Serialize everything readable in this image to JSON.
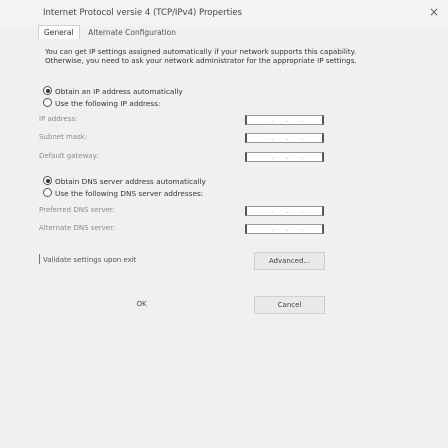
{
  "window": {
    "title": "Internet Protocol versie 4 (TCP/IPv4) Properties",
    "close_glyph": "×"
  },
  "tabs": [
    {
      "label": "General",
      "active": true
    },
    {
      "label": "Alternate Configuration",
      "active": false
    }
  ],
  "description": "You can get IP settings assigned automatically if your network supports this capability. Otherwise, you need to ask your network administrator for the appropriate IP settings.",
  "ip_section": {
    "auto_label": "Obtain an IP address automatically",
    "manual_label": "Use the following IP address:",
    "selected": "auto",
    "fields": [
      {
        "label": "IP address:",
        "value": ".   .   ."
      },
      {
        "label": "Subnet mask:",
        "value": ".   .   ."
      },
      {
        "label": "Default gateway:",
        "value": ".   .   ."
      }
    ]
  },
  "dns_section": {
    "auto_label": "Obtain DNS server address automatically",
    "manual_label": "Use the following DNS server addresses:",
    "selected": "auto",
    "fields": [
      {
        "label": "Preferred DNS server:",
        "value": ".   .   ."
      },
      {
        "label": "Alternate DNS server:",
        "value": ".   .   ."
      }
    ]
  },
  "validate_label": "Validate settings upon exit",
  "buttons": {
    "advanced": "Advanced...",
    "ok": "OK",
    "cancel": "Cancel"
  }
}
